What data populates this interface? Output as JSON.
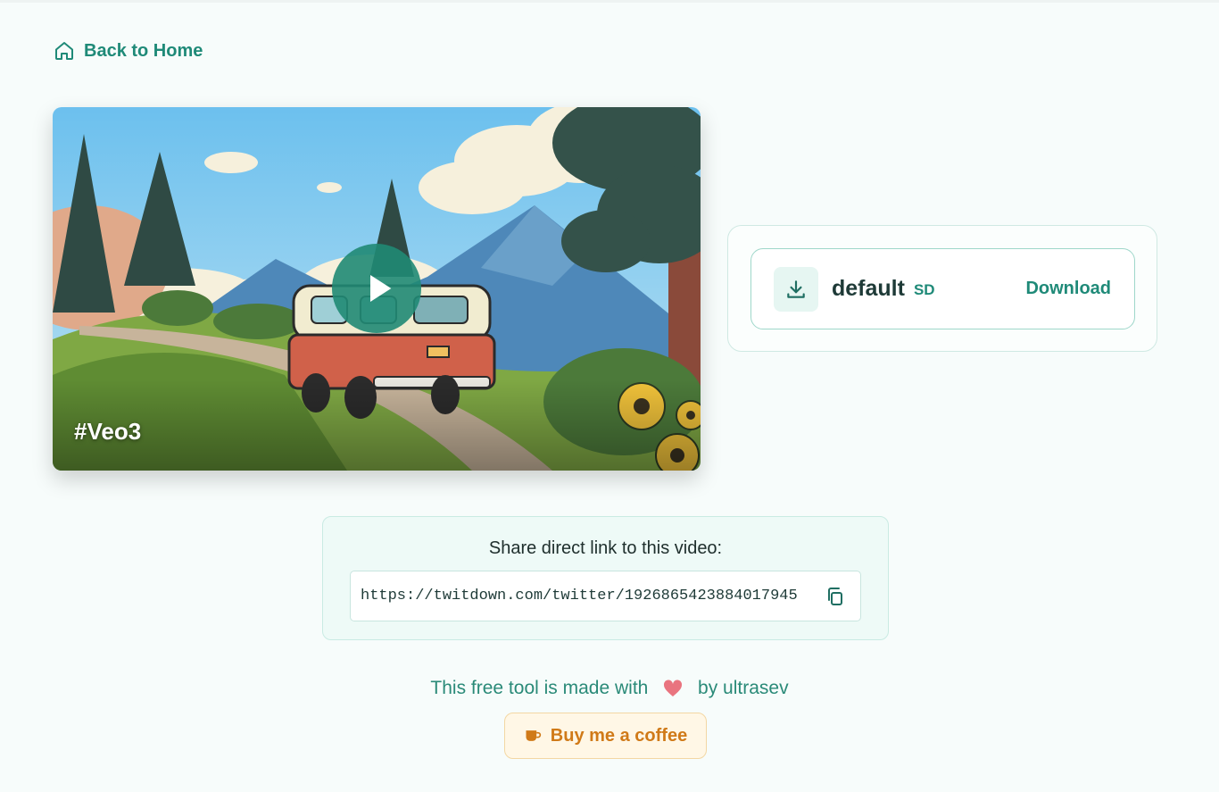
{
  "nav": {
    "back_label": "Back to Home",
    "icon": "home-icon"
  },
  "video": {
    "hashtag": "#Veo3",
    "play_icon": "play-icon"
  },
  "download": {
    "name": "default",
    "quality": "SD",
    "button_label": "Download",
    "icon": "download-icon"
  },
  "share": {
    "title": "Share direct link to this video:",
    "url": "https://twitdown.com/twitter/1926865423884017945",
    "copy_icon": "copy-icon"
  },
  "footer": {
    "made_prefix": "This free tool is made with",
    "made_suffix": "by ultrasev",
    "coffee_label": "Buy me a coffee"
  },
  "colors": {
    "accent": "#1f8a78",
    "background": "#f7fcfb",
    "coffee": "#d07a18"
  }
}
